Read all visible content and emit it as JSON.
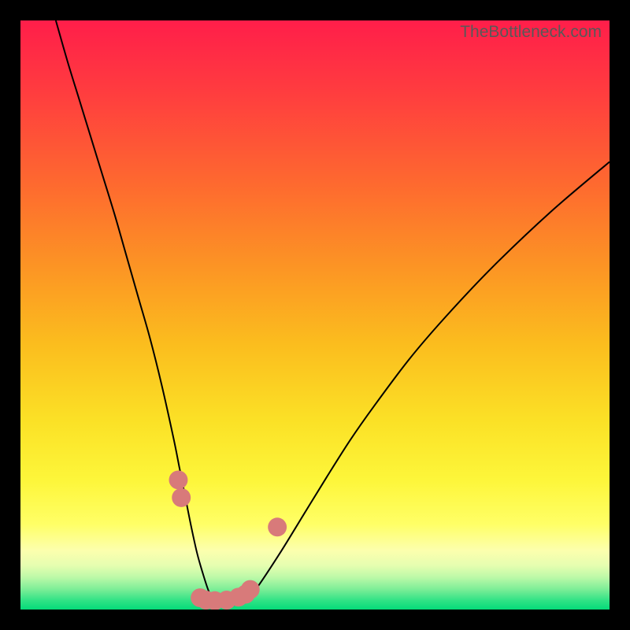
{
  "watermark": "TheBottleneck.com",
  "chart_data": {
    "type": "line",
    "title": "",
    "xlabel": "",
    "ylabel": "",
    "xlim": [
      0,
      100
    ],
    "ylim": [
      0,
      100
    ],
    "grid": false,
    "series": [
      {
        "name": "bottleneck-curve",
        "color": "#000000",
        "x": [
          6,
          8,
          10,
          12,
          14,
          16,
          18,
          20,
          22,
          24,
          26,
          27,
          28,
          29,
          30,
          31,
          32,
          33,
          34,
          35,
          36,
          38,
          40,
          44,
          48,
          52,
          56,
          60,
          66,
          72,
          80,
          90,
          100
        ],
        "y": [
          100,
          93,
          86.5,
          80,
          73.5,
          67,
          60,
          53,
          46,
          38,
          29,
          24,
          19,
          14,
          9.5,
          6,
          3,
          1.3,
          0.7,
          0.6,
          0.7,
          1.5,
          3.5,
          9.5,
          16,
          22.5,
          28.8,
          34.5,
          42.5,
          49.5,
          58,
          67.5,
          76
        ]
      }
    ],
    "markers": [
      {
        "name": "dot-left-a",
        "x": 26.8,
        "y": 22,
        "r": 1.6,
        "color": "#D87A7A"
      },
      {
        "name": "dot-left-b",
        "x": 27.3,
        "y": 19,
        "r": 1.6,
        "color": "#D87A7A"
      },
      {
        "name": "dot-bottom-a",
        "x": 30.5,
        "y": 2.0,
        "r": 1.6,
        "color": "#D87A7A"
      },
      {
        "name": "dot-bottom-b",
        "x": 31.5,
        "y": 1.6,
        "r": 1.6,
        "color": "#D87A7A"
      },
      {
        "name": "dot-bottom-c",
        "x": 33.0,
        "y": 1.5,
        "r": 1.6,
        "color": "#D87A7A"
      },
      {
        "name": "dot-bottom-d",
        "x": 35.0,
        "y": 1.6,
        "r": 1.6,
        "color": "#D87A7A"
      },
      {
        "name": "dot-bottom-e",
        "x": 37.0,
        "y": 2.1,
        "r": 1.6,
        "color": "#D87A7A"
      },
      {
        "name": "dot-bottom-f",
        "x": 38.2,
        "y": 2.6,
        "r": 1.6,
        "color": "#D87A7A"
      },
      {
        "name": "dot-bottom-g",
        "x": 39.0,
        "y": 3.4,
        "r": 1.6,
        "color": "#D87A7A"
      },
      {
        "name": "dot-right-a",
        "x": 43.6,
        "y": 14.0,
        "r": 1.6,
        "color": "#D87A7A"
      }
    ],
    "background_gradient": {
      "type": "vertical",
      "stops": [
        {
          "offset": 0.0,
          "color": "#FF1E4A"
        },
        {
          "offset": 0.12,
          "color": "#FF3C3F"
        },
        {
          "offset": 0.28,
          "color": "#FE6A2F"
        },
        {
          "offset": 0.42,
          "color": "#FC9524"
        },
        {
          "offset": 0.55,
          "color": "#FBBD1E"
        },
        {
          "offset": 0.68,
          "color": "#FBE126"
        },
        {
          "offset": 0.78,
          "color": "#FDF63A"
        },
        {
          "offset": 0.855,
          "color": "#FFFF66"
        },
        {
          "offset": 0.9,
          "color": "#FCFFAE"
        },
        {
          "offset": 0.925,
          "color": "#E6FEB0"
        },
        {
          "offset": 0.945,
          "color": "#BDF9A8"
        },
        {
          "offset": 0.965,
          "color": "#7FEE98"
        },
        {
          "offset": 0.985,
          "color": "#2FE285"
        },
        {
          "offset": 1.0,
          "color": "#05DB79"
        }
      ]
    }
  }
}
